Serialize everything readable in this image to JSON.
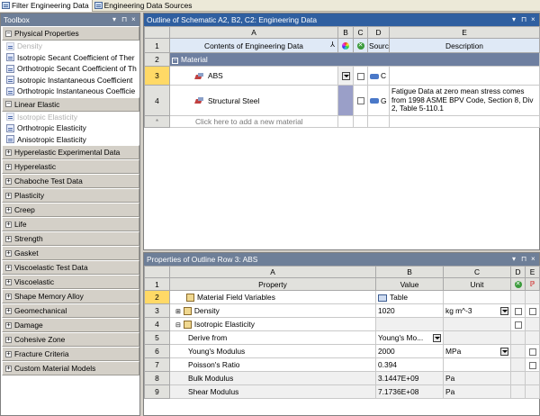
{
  "tabs": [
    {
      "label": "Filter Engineering Data",
      "icon": "filter-icon"
    },
    {
      "label": "Engineering Data Sources",
      "icon": "data-sources-icon"
    }
  ],
  "toolbox": {
    "title": "Toolbox",
    "controls": [
      "▾",
      "⊓",
      "×"
    ],
    "sections": [
      {
        "label": "Physical Properties",
        "expanded": true,
        "items": [
          {
            "label": "Density",
            "disabled": true
          },
          {
            "label": "Isotropic Secant Coefficient of Ther",
            "disabled": false
          },
          {
            "label": "Orthotropic Secant Coefficient of Th",
            "disabled": false
          },
          {
            "label": "Isotropic Instantaneous Coefficient",
            "disabled": false
          },
          {
            "label": "Orthotropic Instantaneous Coefficie",
            "disabled": false
          }
        ]
      },
      {
        "label": "Linear Elastic",
        "expanded": true,
        "items": [
          {
            "label": "Isotropic Elasticity",
            "disabled": true
          },
          {
            "label": "Orthotropic Elasticity",
            "disabled": false
          },
          {
            "label": "Anisotropic Elasticity",
            "disabled": false
          }
        ]
      },
      {
        "label": "Hyperelastic Experimental Data",
        "expanded": false
      },
      {
        "label": "Hyperelastic",
        "expanded": false
      },
      {
        "label": "Chaboche Test Data",
        "expanded": false
      },
      {
        "label": "Plasticity",
        "expanded": false
      },
      {
        "label": "Creep",
        "expanded": false
      },
      {
        "label": "Life",
        "expanded": false
      },
      {
        "label": "Strength",
        "expanded": false
      },
      {
        "label": "Gasket",
        "expanded": false
      },
      {
        "label": "Viscoelastic Test Data",
        "expanded": false
      },
      {
        "label": "Viscoelastic",
        "expanded": false
      },
      {
        "label": "Shape Memory Alloy",
        "expanded": false
      },
      {
        "label": "Geomechanical",
        "expanded": false
      },
      {
        "label": "Damage",
        "expanded": false
      },
      {
        "label": "Cohesive Zone",
        "expanded": false
      },
      {
        "label": "Fracture Criteria",
        "expanded": false
      },
      {
        "label": "Custom Material Models",
        "expanded": false
      }
    ]
  },
  "outline": {
    "title": "Outline of Schematic A2, B2, C2: Engineering Data",
    "controls": [
      "▾",
      "⊓",
      "×"
    ],
    "col_letters": [
      "A",
      "B",
      "C",
      "D",
      "E"
    ],
    "col_headers": [
      "Contents of Engineering Data",
      "Source",
      "Description"
    ],
    "group_label": "Material",
    "rows": [
      {
        "num": "3",
        "name": "ABS",
        "source": "C",
        "description": "",
        "selected": true
      },
      {
        "num": "4",
        "name": "Structural Steel",
        "source": "G",
        "description": "Fatigue Data at zero mean stress comes from 1998 ASME BPV Code, Section 8, Div 2, Table 5-110.1",
        "selected": false
      }
    ],
    "new_row_marker": "*",
    "new_row_placeholder": "Click here to add a new material"
  },
  "properties": {
    "title": "Properties of Outline Row 3: ABS",
    "controls": [
      "▾",
      "⊓",
      "×"
    ],
    "col_letters": [
      "A",
      "B",
      "C",
      "D",
      "E"
    ],
    "col_headers": [
      "Property",
      "Value",
      "Unit"
    ],
    "rows": [
      {
        "num": "1",
        "property": "",
        "value": "",
        "unit": ""
      },
      {
        "num": "2",
        "property": "Material Field Variables",
        "value": "Table",
        "unit": ""
      },
      {
        "num": "3",
        "property": "Density",
        "value": "1020",
        "unit": "kg m^-3"
      },
      {
        "num": "4",
        "property": "Isotropic Elasticity",
        "value": "",
        "unit": ""
      },
      {
        "num": "5",
        "property": "Derive from",
        "value": "Young's Mo...",
        "unit": ""
      },
      {
        "num": "6",
        "property": "Young's Modulus",
        "value": "2000",
        "unit": "MPa"
      },
      {
        "num": "7",
        "property": "Poisson's Ratio",
        "value": "0.394",
        "unit": ""
      },
      {
        "num": "8",
        "property": "Bulk Modulus",
        "value": "3.1447E+09",
        "unit": "Pa"
      },
      {
        "num": "9",
        "property": "Shear Modulus",
        "value": "7.1736E+08",
        "unit": "Pa"
      }
    ]
  }
}
